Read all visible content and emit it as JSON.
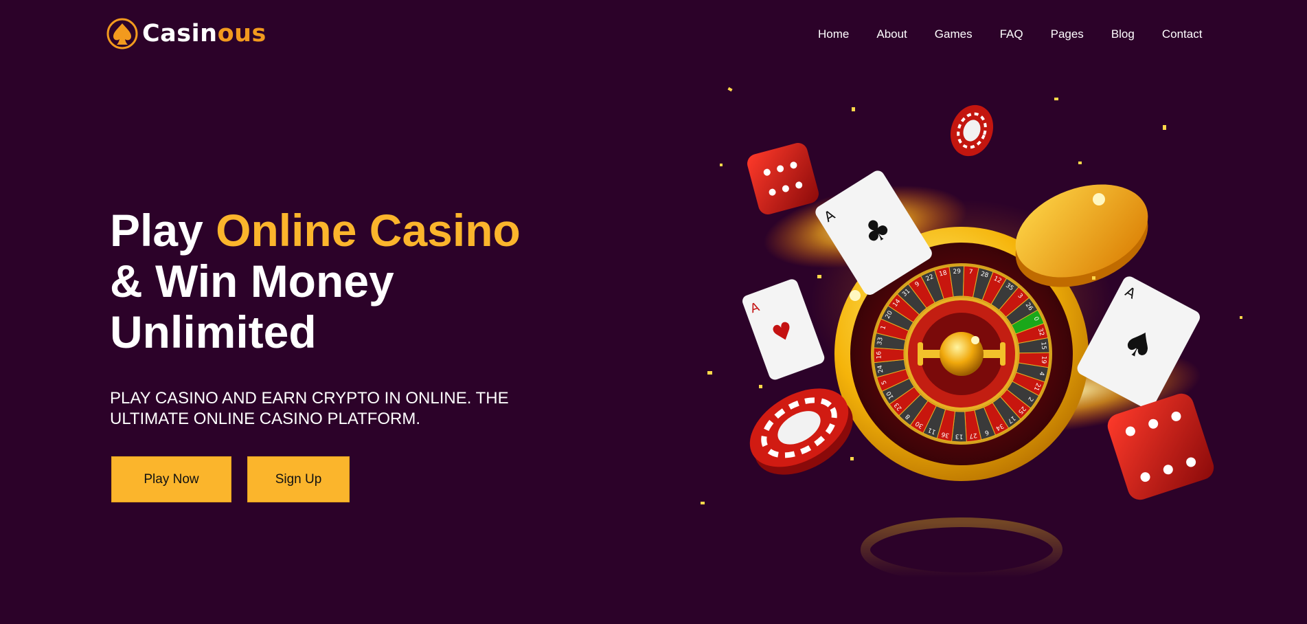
{
  "header": {
    "logo": {
      "text_main": "Casin",
      "text_accent": "ous",
      "icon": "spade-icon",
      "accent_color": "#f29a1e"
    },
    "nav": [
      "Home",
      "About",
      "Games",
      "FAQ",
      "Pages",
      "Blog",
      "Contact"
    ]
  },
  "hero": {
    "headline_line1_plain": "Play ",
    "headline_line1_highlight": "Online Casino",
    "headline_line2": "& Win Money",
    "headline_line3": "Unlimited",
    "subtitle": "PLAY CASINO AND EARN CRYPTO IN ONLINE. THE ULTIMATE ONLINE CASINO PLATFORM.",
    "buttons": {
      "play": "Play Now",
      "signup": "Sign Up"
    }
  },
  "illustration": {
    "roulette_numbers": [
      "0",
      "32",
      "15",
      "19",
      "4",
      "21",
      "2",
      "25",
      "17",
      "34",
      "6",
      "27",
      "13",
      "36",
      "11",
      "30",
      "8",
      "23",
      "10",
      "5",
      "24",
      "16",
      "33",
      "1",
      "20",
      "14",
      "31",
      "9",
      "22",
      "18",
      "29",
      "7",
      "28",
      "12",
      "35",
      "3",
      "26"
    ],
    "card_left": "A",
    "card_top": "A",
    "card_right": "A"
  },
  "colors": {
    "background": "#2c0229",
    "accent": "#fbb52c",
    "text": "#ffffff"
  }
}
